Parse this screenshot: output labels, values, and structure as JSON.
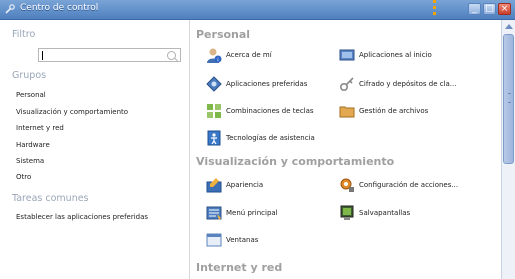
{
  "window": {
    "title": "Centro de control"
  },
  "sidebar": {
    "filter_title": "Filtro",
    "search_value": "",
    "groups_title": "Grupos",
    "groups": [
      {
        "label": "Personal"
      },
      {
        "label": "Visualización y comportamiento"
      },
      {
        "label": "Internet y red"
      },
      {
        "label": "Hardware"
      },
      {
        "label": "Sistema"
      },
      {
        "label": "Otro"
      }
    ],
    "tasks_title": "Tareas comunes",
    "tasks": [
      {
        "label": "Establecer las aplicaciones preferidas"
      }
    ]
  },
  "main": {
    "categories": [
      {
        "title": "Personal",
        "items": [
          {
            "label": "Acerca de mí",
            "icon": "user-info-icon"
          },
          {
            "label": "Aplicaciones al inicio",
            "icon": "startup-apps-icon"
          },
          {
            "label": "Aplicaciones preferidas",
            "icon": "preferred-apps-icon"
          },
          {
            "label": "Cifrado y depósitos de cla...",
            "icon": "encryption-keys-icon"
          },
          {
            "label": "Combinaciones de teclas",
            "icon": "keyboard-shortcuts-icon"
          },
          {
            "label": "Gestión de archivos",
            "icon": "file-management-icon"
          },
          {
            "label": "Tecnologías de asistencia",
            "icon": "accessibility-icon"
          }
        ]
      },
      {
        "title": "Visualización y comportamiento",
        "items": [
          {
            "label": "Apariencia",
            "icon": "appearance-icon"
          },
          {
            "label": "Configuración de acciones...",
            "icon": "actions-config-icon"
          },
          {
            "label": "Menú principal",
            "icon": "main-menu-icon"
          },
          {
            "label": "Salvapantallas",
            "icon": "screensaver-icon"
          },
          {
            "label": "Ventanas",
            "icon": "windows-icon"
          }
        ]
      },
      {
        "title": "Internet y red",
        "items": []
      }
    ]
  },
  "colors": {
    "titlebar": "#5f8cc8",
    "category_title": "#a0a0a0",
    "sidebar_section": "#9aa6b8",
    "accent_dots": "#f5a300"
  }
}
